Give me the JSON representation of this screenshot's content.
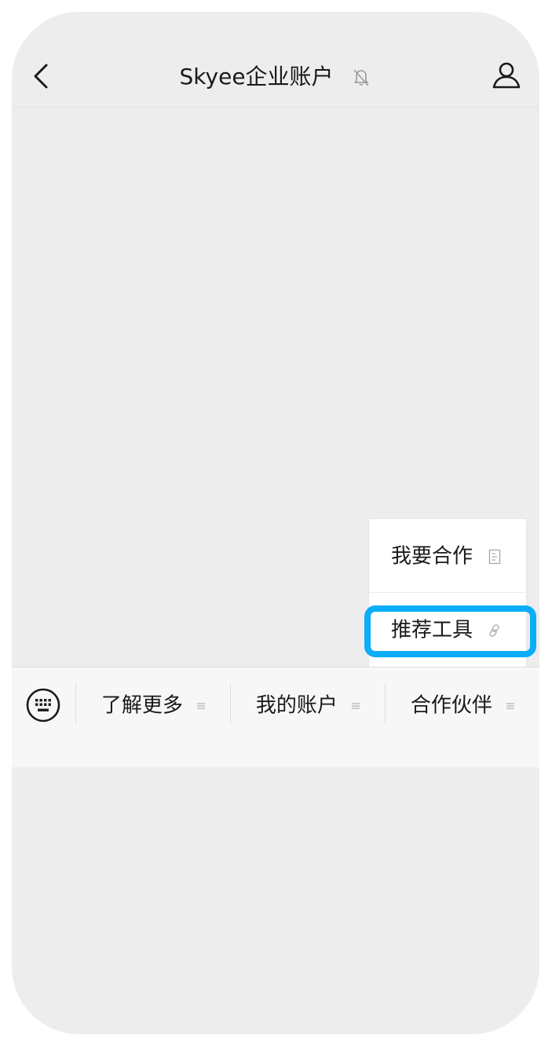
{
  "header": {
    "title": "Skyee企业账户",
    "back_icon": "chevron-left-icon",
    "mute_icon": "bell-off-icon",
    "profile_icon": "person-icon"
  },
  "popup_menu": {
    "items": [
      {
        "label": "我要合作",
        "icon": "document-icon"
      },
      {
        "label": "推荐工具",
        "icon": "link-icon",
        "highlighted": true
      }
    ],
    "highlight_color": "#0aadf7"
  },
  "bottom_menu": {
    "keyboard_icon": "keyboard-icon",
    "items": [
      {
        "label": "了解更多",
        "icon": "menu-lines-icon"
      },
      {
        "label": "我的账户",
        "icon": "menu-lines-icon"
      },
      {
        "label": "合作伙伴",
        "icon": "menu-lines-icon"
      }
    ]
  },
  "colors": {
    "background": "#ededed",
    "menubar": "#f7f7f7",
    "popup": "#ffffff"
  }
}
